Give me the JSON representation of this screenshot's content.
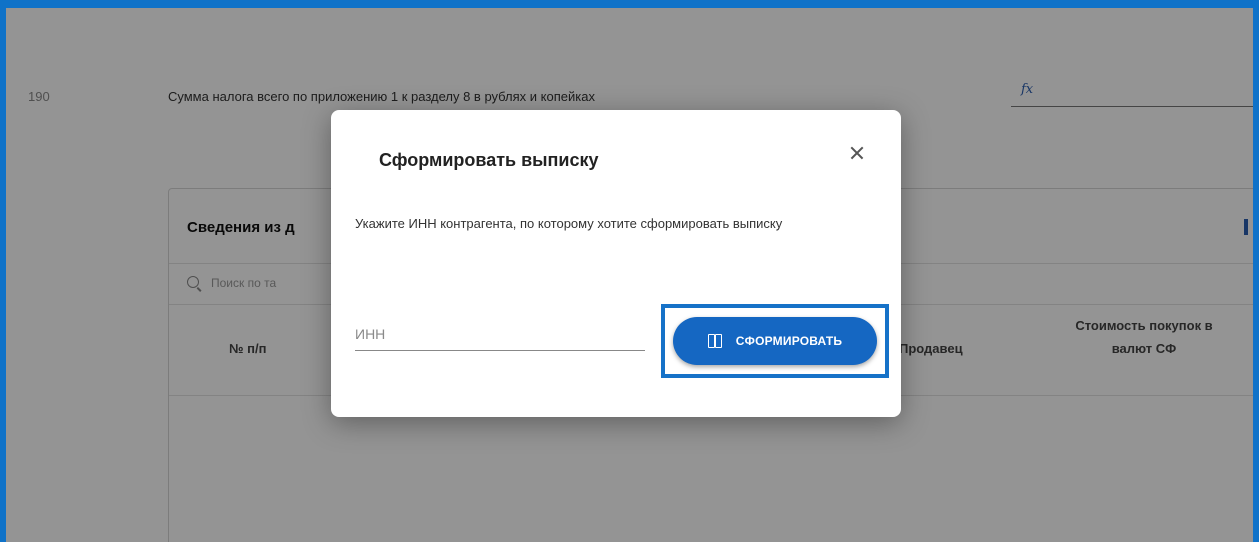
{
  "background_page": {
    "row": {
      "number": "190",
      "label": "Сумма налога всего по приложению 1 к разделу 8 в рублях и копейках",
      "fx_icon": "fx"
    },
    "card": {
      "title": "Сведения из д",
      "search_placeholder": "Поиск по та",
      "columns": {
        "number": "№ п/п",
        "seller": "Продавец",
        "cost": "Стоимость покупок в валют СФ"
      }
    }
  },
  "modal": {
    "title": "Сформировать выписку",
    "close_icon": "close-icon",
    "description": "Укажите ИНН контрагента, по которому хотите сформировать выписку",
    "inn_placeholder": "ИНН",
    "inn_value": "",
    "submit_button": {
      "label": "СФОРМИРОВАТЬ",
      "icon": "document-icon"
    }
  },
  "colors": {
    "frame": "#0f72c8",
    "primary_button": "#1567c2",
    "highlight": "#1672c8"
  }
}
